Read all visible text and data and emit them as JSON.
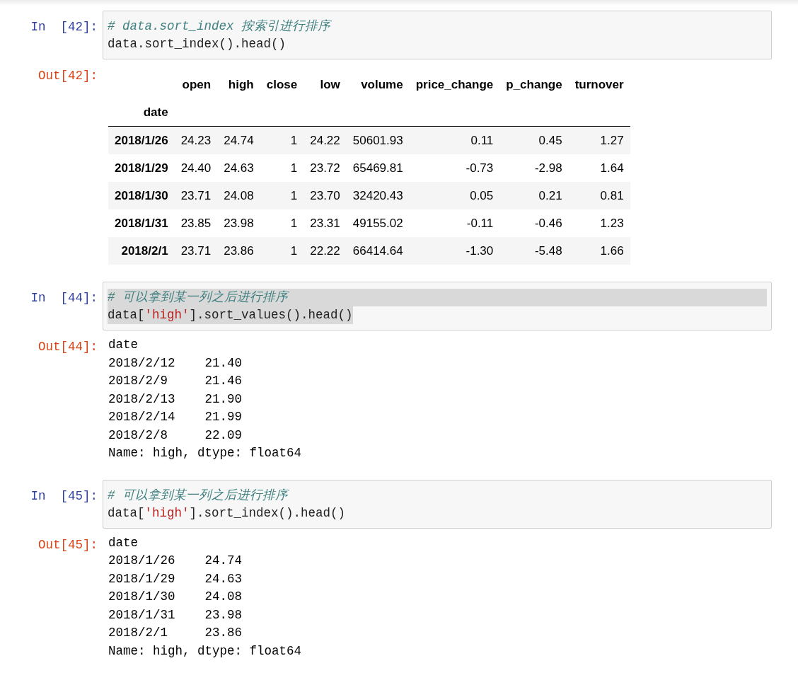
{
  "cells": [
    {
      "in_prompt": "In  [42]:",
      "text_selected": false,
      "code": [
        [
          {
            "kind": "comment",
            "text": "# data.sort_index 按索引进行排序"
          }
        ],
        [
          {
            "kind": "plain",
            "text": "data.sort_index().head()"
          }
        ]
      ],
      "out_prompt": "Out[42]:",
      "output": {
        "kind": "table",
        "columns": [
          "open",
          "high",
          "close",
          "low",
          "volume",
          "price_change",
          "p_change",
          "turnover"
        ],
        "index_name": "date",
        "rows": [
          {
            "index": "2018/1/26",
            "values": [
              "24.23",
              "24.74",
              "1",
              "24.22",
              "50601.93",
              "0.11",
              "0.45",
              "1.27"
            ]
          },
          {
            "index": "2018/1/29",
            "values": [
              "24.40",
              "24.63",
              "1",
              "23.72",
              "65469.81",
              "-0.73",
              "-2.98",
              "1.64"
            ]
          },
          {
            "index": "2018/1/30",
            "values": [
              "23.71",
              "24.08",
              "1",
              "23.70",
              "32420.43",
              "0.05",
              "0.21",
              "0.81"
            ]
          },
          {
            "index": "2018/1/31",
            "values": [
              "23.85",
              "23.98",
              "1",
              "23.31",
              "49155.02",
              "-0.11",
              "-0.46",
              "1.23"
            ]
          },
          {
            "index": "2018/2/1",
            "values": [
              "23.71",
              "23.86",
              "1",
              "22.22",
              "66414.64",
              "-1.30",
              "-5.48",
              "1.66"
            ]
          }
        ]
      }
    },
    {
      "in_prompt": "In  [44]:",
      "text_selected": true,
      "code": [
        [
          {
            "kind": "comment",
            "text": "# 可以拿到某一列之后进行排序"
          }
        ],
        [
          {
            "kind": "plain",
            "text": "data["
          },
          {
            "kind": "string",
            "text": "'high'"
          },
          {
            "kind": "plain",
            "text": "].sort_values().head()"
          }
        ]
      ],
      "out_prompt": "Out[44]:",
      "output": {
        "kind": "text",
        "lines": [
          "date",
          "2018/2/12    21.40",
          "2018/2/9     21.46",
          "2018/2/13    21.90",
          "2018/2/14    21.99",
          "2018/2/8     22.09",
          "Name: high, dtype: float64"
        ]
      }
    },
    {
      "in_prompt": "In  [45]:",
      "text_selected": false,
      "code": [
        [
          {
            "kind": "comment",
            "text": "# 可以拿到某一列之后进行排序"
          }
        ],
        [
          {
            "kind": "plain",
            "text": "data["
          },
          {
            "kind": "string",
            "text": "'high'"
          },
          {
            "kind": "plain",
            "text": "].sort_index().head()"
          }
        ]
      ],
      "out_prompt": "Out[45]:",
      "output": {
        "kind": "text",
        "lines": [
          "date",
          "2018/1/26    24.74",
          "2018/1/29    24.63",
          "2018/1/30    24.08",
          "2018/1/31    23.98",
          "2018/2/1     23.86",
          "Name: high, dtype: float64"
        ]
      }
    }
  ]
}
